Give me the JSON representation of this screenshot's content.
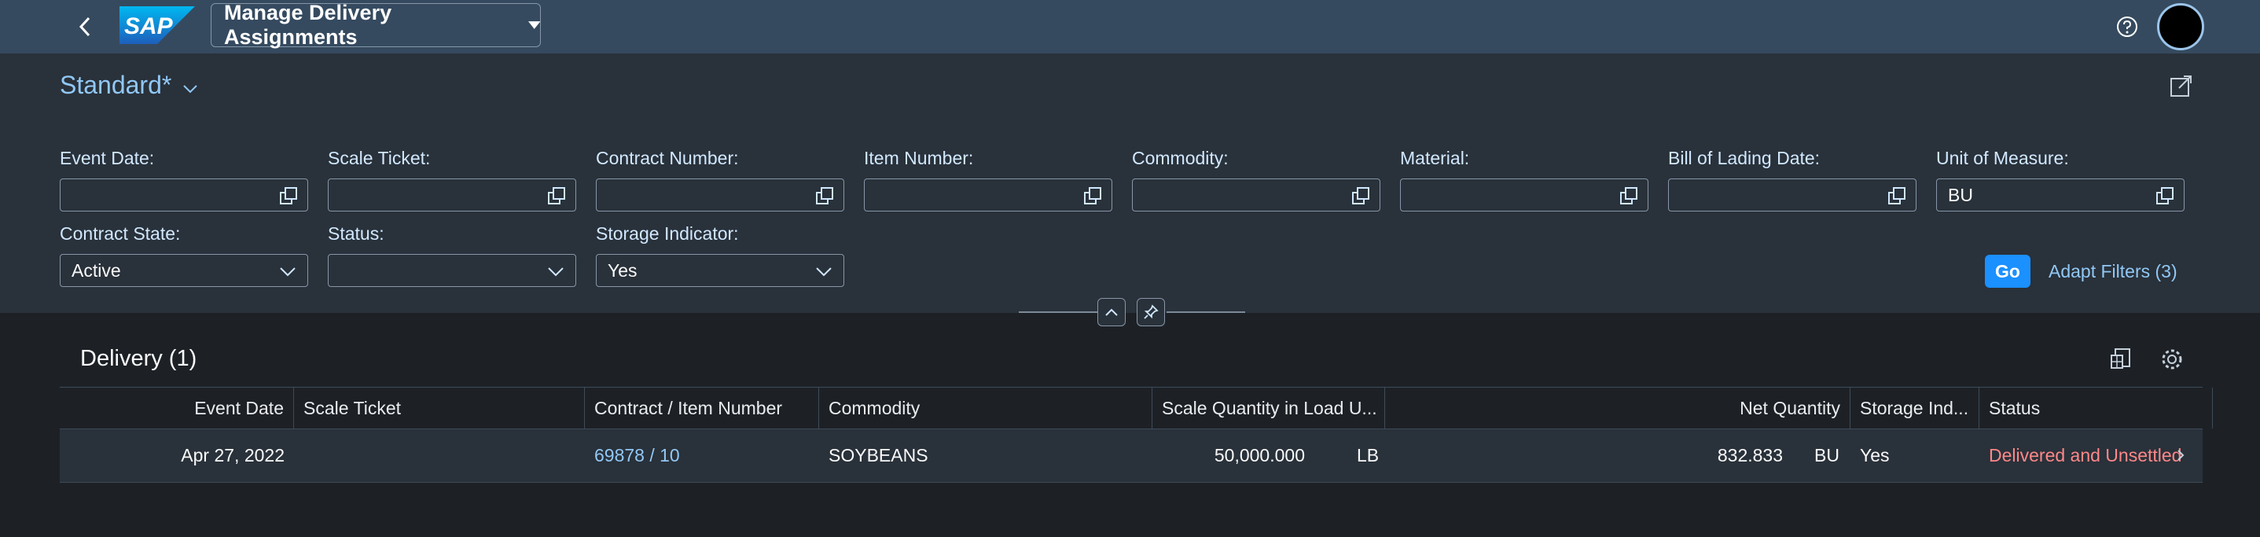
{
  "shell": {
    "app_title": "Manage Delivery Assignments",
    "logo_text": "SAP",
    "icons": [
      "back-icon",
      "help-icon",
      "avatar"
    ]
  },
  "variant": {
    "title": "Standard*"
  },
  "filters": {
    "event_date": {
      "label": "Event Date:",
      "value": ""
    },
    "scale_ticket": {
      "label": "Scale Ticket:",
      "value": ""
    },
    "contract_number": {
      "label": "Contract Number:",
      "value": ""
    },
    "item_number": {
      "label": "Item Number:",
      "value": ""
    },
    "commodity": {
      "label": "Commodity:",
      "value": ""
    },
    "material": {
      "label": "Material:",
      "value": ""
    },
    "bill_of_lading_date": {
      "label": "Bill of Lading Date:",
      "value": ""
    },
    "unit_of_measure": {
      "label": "Unit of Measure:",
      "value": "BU"
    },
    "contract_state": {
      "label": "Contract State:",
      "value": "Active"
    },
    "status": {
      "label": "Status:",
      "value": ""
    },
    "storage_indicator": {
      "label": "Storage Indicator:",
      "value": "Yes"
    },
    "go_label": "Go",
    "adapt_label": "Adapt Filters (3)"
  },
  "table": {
    "title": "Delivery (1)",
    "columns": {
      "event_date": "Event Date",
      "scale_ticket": "Scale Ticket",
      "contract_item": "Contract / Item Number",
      "commodity": "Commodity",
      "scale_qty": "Scale Quantity in Load U...",
      "net_qty": "Net Quantity",
      "storage_ind": "Storage Ind...",
      "status": "Status"
    },
    "rows": [
      {
        "event_date": "Apr 27, 2022",
        "scale_ticket": "",
        "contract_item": "69878 / 10",
        "commodity": "SOYBEANS",
        "scale_qty": "50,000.000",
        "scale_unit": "LB",
        "net_qty": "832.833",
        "net_unit": "BU",
        "storage_ind": "Yes",
        "status": "Delivered and Unsettled"
      }
    ]
  },
  "colors": {
    "shell": "#354a5f",
    "filterbar": "#29313a",
    "page": "#1d2126",
    "accent": "#1b90ff",
    "link": "#91c8f6",
    "negative": "#ff8888"
  }
}
